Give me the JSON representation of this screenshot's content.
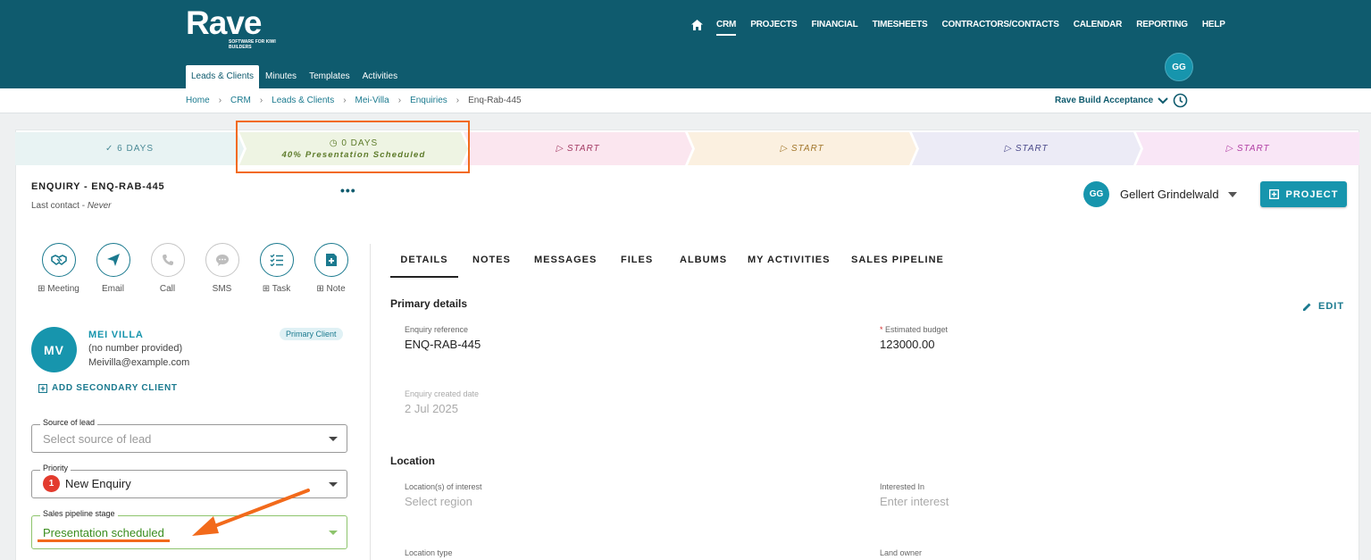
{
  "brand": {
    "name": "Rave",
    "tagline": "SOFTWARE FOR KIWI BUILDERS"
  },
  "main_nav": [
    "CRM",
    "PROJECTS",
    "FINANCIAL",
    "TIMESHEETS",
    "CONTRACTORS/CONTACTS",
    "CALENDAR",
    "REPORTING",
    "HELP"
  ],
  "sub_nav": [
    "Leads & Clients",
    "Minutes",
    "Templates",
    "Activities"
  ],
  "user_initials": "GG",
  "breadcrumb": [
    "Home",
    "CRM",
    "Leads & Clients",
    "Mei-Villa",
    "Enquiries",
    "Enq-Rab-445"
  ],
  "company_selector": "Rave Build Acceptance",
  "pipeline": [
    {
      "label": "6 DAYS",
      "status": "done",
      "color": "#e8f3f3"
    },
    {
      "label": "0 DAYS",
      "sub": "40% Presentation Scheduled",
      "status": "current",
      "color": "#eef4e3"
    },
    {
      "label": "START",
      "color": "#fbe6ef"
    },
    {
      "label": "START",
      "color": "#fbf0e0"
    },
    {
      "label": "START",
      "color": "#ecebf6"
    },
    {
      "label": "START",
      "color": "#f9e6f6"
    }
  ],
  "enquiry": {
    "title": "ENQUIRY - ENQ-RAB-445",
    "last_contact_label": "Last contact - ",
    "last_contact_value": "Never"
  },
  "actions": [
    {
      "label": "Meeting",
      "icon": "handshake-icon",
      "plus": true
    },
    {
      "label": "Email",
      "icon": "paper-plane-icon",
      "plus": false
    },
    {
      "label": "Call",
      "icon": "phone-icon",
      "plus": false
    },
    {
      "label": "SMS",
      "icon": "chat-bubble-icon",
      "plus": false
    },
    {
      "label": "Task",
      "icon": "task-list-icon",
      "plus": true
    },
    {
      "label": "Note",
      "icon": "note-add-icon",
      "plus": true
    }
  ],
  "client": {
    "initials": "MV",
    "name": "MEI VILLA",
    "phone": "(no number provided)",
    "email": "Meivilla@example.com",
    "badge": "Primary Client"
  },
  "add_secondary": "ADD SECONDARY CLIENT",
  "fields": {
    "source": {
      "label": "Source of lead",
      "placeholder": "Select source of lead"
    },
    "priority": {
      "label": "Priority",
      "number": "1",
      "value": "New Enquiry"
    },
    "stage": {
      "label": "Sales pipeline stage",
      "value": "Presentation scheduled"
    }
  },
  "owner": {
    "initials": "GG",
    "name": "Gellert Grindelwald"
  },
  "project_button": "PROJECT",
  "tabs": [
    "DETAILS",
    "NOTES",
    "MESSAGES",
    "FILES",
    "ALBUMS",
    "MY ACTIVITIES",
    "SALES PIPELINE"
  ],
  "primary_details": {
    "title": "Primary details",
    "edit": "EDIT",
    "enquiry_reference_label": "Enquiry reference",
    "enquiry_reference": "ENQ-RAB-445",
    "estimated_budget_label": "Estimated budget",
    "estimated_budget": "123000.00",
    "created_label": "Enquiry created date",
    "created": "2 Jul 2025"
  },
  "location": {
    "title": "Location",
    "locations_label": "Location(s) of interest",
    "locations_placeholder": "Select region",
    "interested_label": "Interested In",
    "interested_placeholder": "Enter interest",
    "type_label": "Location type",
    "owner_label": "Land owner"
  },
  "accent": "#0f5b6e",
  "annotation_color": "#f26a1b"
}
